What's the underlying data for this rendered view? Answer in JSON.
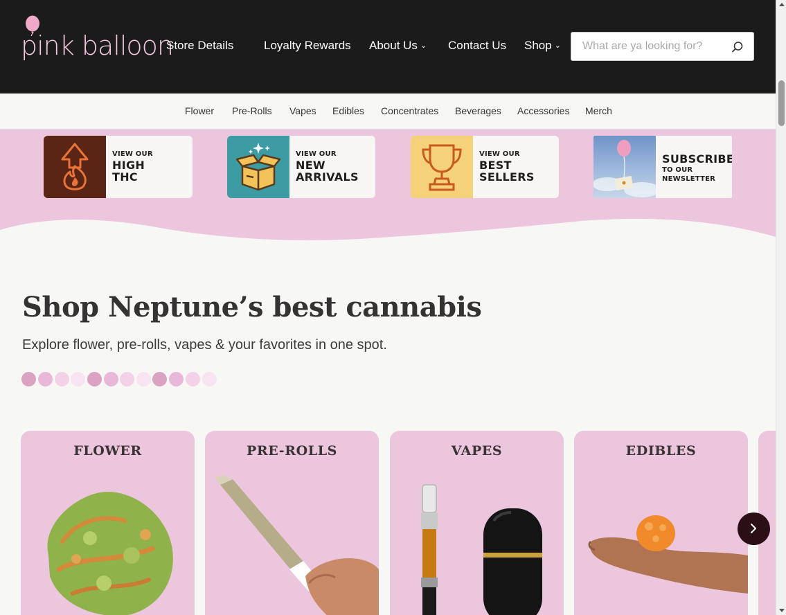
{
  "brand": {
    "logo_text": "pink balloon"
  },
  "nav": {
    "store_details": "Store Details",
    "loyalty_rewards": "Loyalty Rewards",
    "about_us": "About Us",
    "contact_us": "Contact Us",
    "shop": "Shop"
  },
  "search": {
    "placeholder": "What are ya looking for?",
    "value": ""
  },
  "subnav": [
    "Flower",
    "Pre-Rolls",
    "Vapes",
    "Edibles",
    "Concentrates",
    "Beverages",
    "Accessories",
    "Merch"
  ],
  "promos": [
    {
      "small": "VIEW OUR",
      "line1": "HIGH",
      "line2": "THC",
      "icon": "flame-arrow-icon"
    },
    {
      "small": "VIEW OUR",
      "line1": "NEW",
      "line2": "ARRIVALS",
      "icon": "open-box-icon"
    },
    {
      "small": "VIEW OUR",
      "line1": "BEST",
      "line2": "SELLERS",
      "icon": "trophy-icon"
    },
    {
      "big": "SUBSCRIBE",
      "small1": "TO OUR",
      "small2": "NEWSLETTER",
      "icon": "balloon-envelope-icon"
    }
  ],
  "hero": {
    "title": "Shop Neptune’s best cannabis",
    "subtitle": "Explore flower, pre-rolls, vapes & your favorites in one spot."
  },
  "categories": [
    "FLOWER",
    "PRE-ROLLS",
    "VAPES",
    "EDIBLES"
  ],
  "colors": {
    "header_bg": "#1c1b1c",
    "pink": "#ecc6dc",
    "accent_dark": "#2a0f17",
    "dot_palette": [
      "#dba2c1",
      "#e9b8d9",
      "#f3d2e7",
      "#f8e3f0"
    ]
  }
}
